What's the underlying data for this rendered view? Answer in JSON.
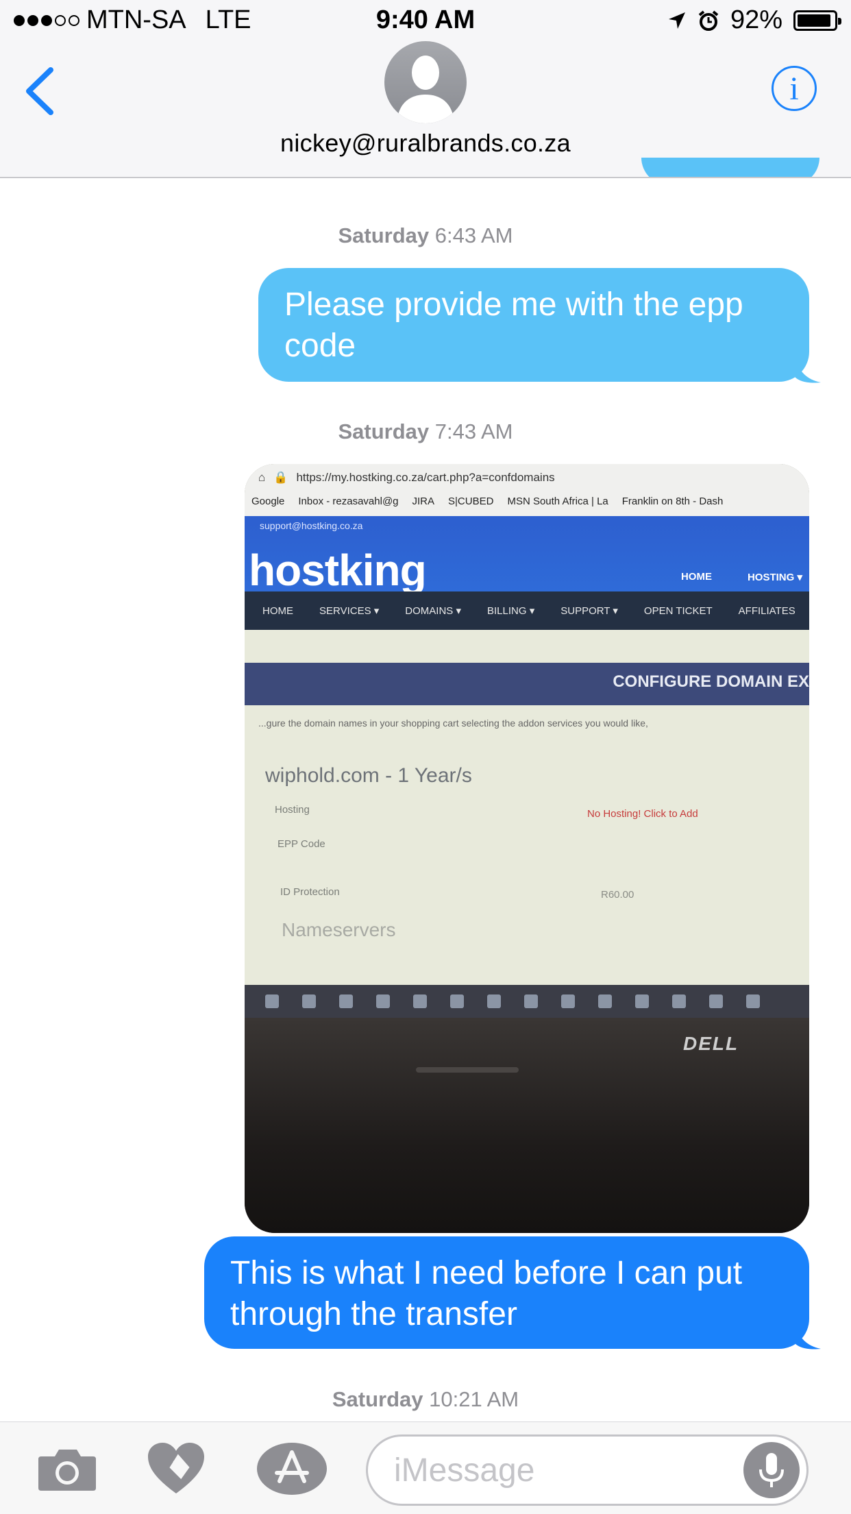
{
  "status_bar": {
    "carrier": "MTN-SA",
    "network": "LTE",
    "time": "9:40 AM",
    "battery": "92%",
    "signal_bars": 3,
    "battery_level": 0.92
  },
  "header": {
    "contact": "nickey@ruralbrands.co.za",
    "back_icon": "chevron-left-icon",
    "info_icon": "info-icon",
    "accent": "#1a82fb"
  },
  "messages": [
    {
      "type": "timestamp",
      "day": "Saturday",
      "time": "6:43 AM"
    },
    {
      "type": "sent",
      "text": "Please provide me with the epp code",
      "color": "#5ac2f7"
    },
    {
      "type": "timestamp",
      "day": "Saturday",
      "time": "7:43 AM"
    },
    {
      "type": "sent-image",
      "description": "photo of laptop screen"
    },
    {
      "type": "sent",
      "text": "This is what I need before I can put through the transfer",
      "color": "#1a82fb"
    },
    {
      "type": "timestamp",
      "day": "Saturday",
      "time": "10:21 AM"
    }
  ],
  "photo": {
    "url": "https://my.hostking.co.za/cart.php?a=confdomains",
    "bookmarks": [
      "Google",
      "Inbox - rezasavahl@g",
      "JIRA",
      "S|CUBED",
      "MSN South Africa | La",
      "Franklin on 8th - Dash"
    ],
    "support_email": "support@hostking.co.za",
    "logo": "hostking",
    "top_nav": [
      "HOME",
      "HOSTING ▾"
    ],
    "main_nav": [
      "HOME",
      "SERVICES ▾",
      "DOMAINS ▾",
      "BILLING ▾",
      "SUPPORT ▾",
      "OPEN TICKET",
      "AFFILIATES"
    ],
    "banner": "CONFIGURE DOMAIN EX",
    "description": "...gure the domain names in your shopping cart selecting the addon services you would like,",
    "domain": "wiphold.com - 1 Year/s",
    "hosting_label": "Hosting",
    "hosting_value": "No Hosting! Click to Add",
    "epp_label": "EPP Code",
    "id_label": "ID Protection",
    "id_value": "R60.00",
    "nameservers": "Nameservers",
    "brand": "DELL"
  },
  "input_bar": {
    "placeholder": "iMessage",
    "camera_icon": "camera-icon",
    "digital_touch_icon": "digital-touch-heart-icon",
    "apps_icon": "app-store-icon",
    "mic_icon": "microphone-icon"
  }
}
